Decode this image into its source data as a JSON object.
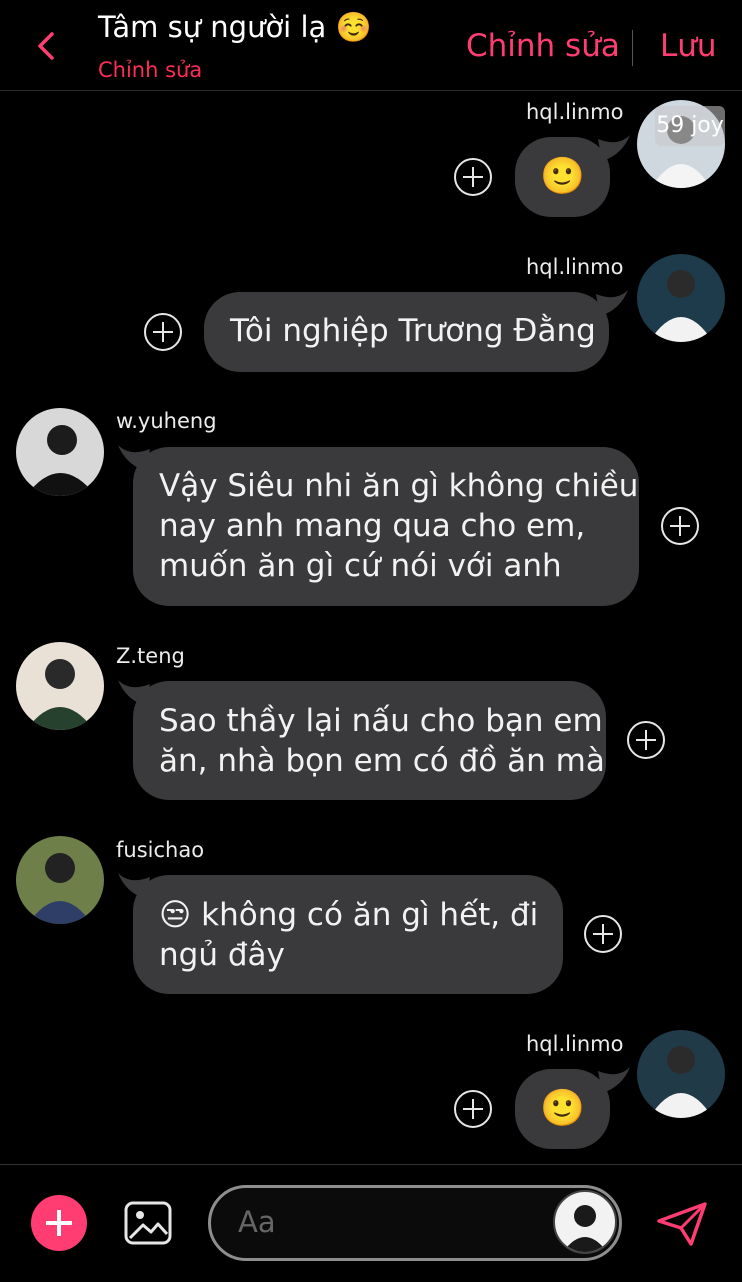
{
  "header": {
    "back_icon": "chevron-left-icon",
    "title": "Tâm sự người lạ ☺️",
    "subtitle": "Chỉnh sửa",
    "edit_label": "Chỉnh sửa",
    "save_label": "Lưu",
    "accent": "#ff3d72"
  },
  "messages": [
    {
      "sender": "hql.linmo",
      "side": "right",
      "text": "🙂"
    },
    {
      "sender": "hql.linmo",
      "side": "right",
      "text": "Tôi nghiệp Trương Đằng"
    },
    {
      "sender": "w.yuheng",
      "side": "left",
      "lines": [
        "Vậy Siêu nhi ăn gì không chiều",
        "nay anh mang qua cho em,",
        "muốn ăn gì cứ nói với anh"
      ]
    },
    {
      "sender": "Z.teng",
      "side": "left",
      "lines": [
        "Sao thầy lại nấu cho bạn em",
        "ăn, nhà bọn em có đồ ăn mà"
      ]
    },
    {
      "sender": "fusichao",
      "side": "left",
      "lines": [
        "😒 không có ăn gì hết, đi",
        "ngủ đây"
      ]
    },
    {
      "sender": "hql.linmo",
      "side": "right",
      "text": "🙂"
    }
  ],
  "watermark": "59 joy",
  "composer": {
    "placeholder": "Aa",
    "add_icon": "plus-icon",
    "image_icon": "image-icon",
    "send_icon": "send-icon"
  }
}
